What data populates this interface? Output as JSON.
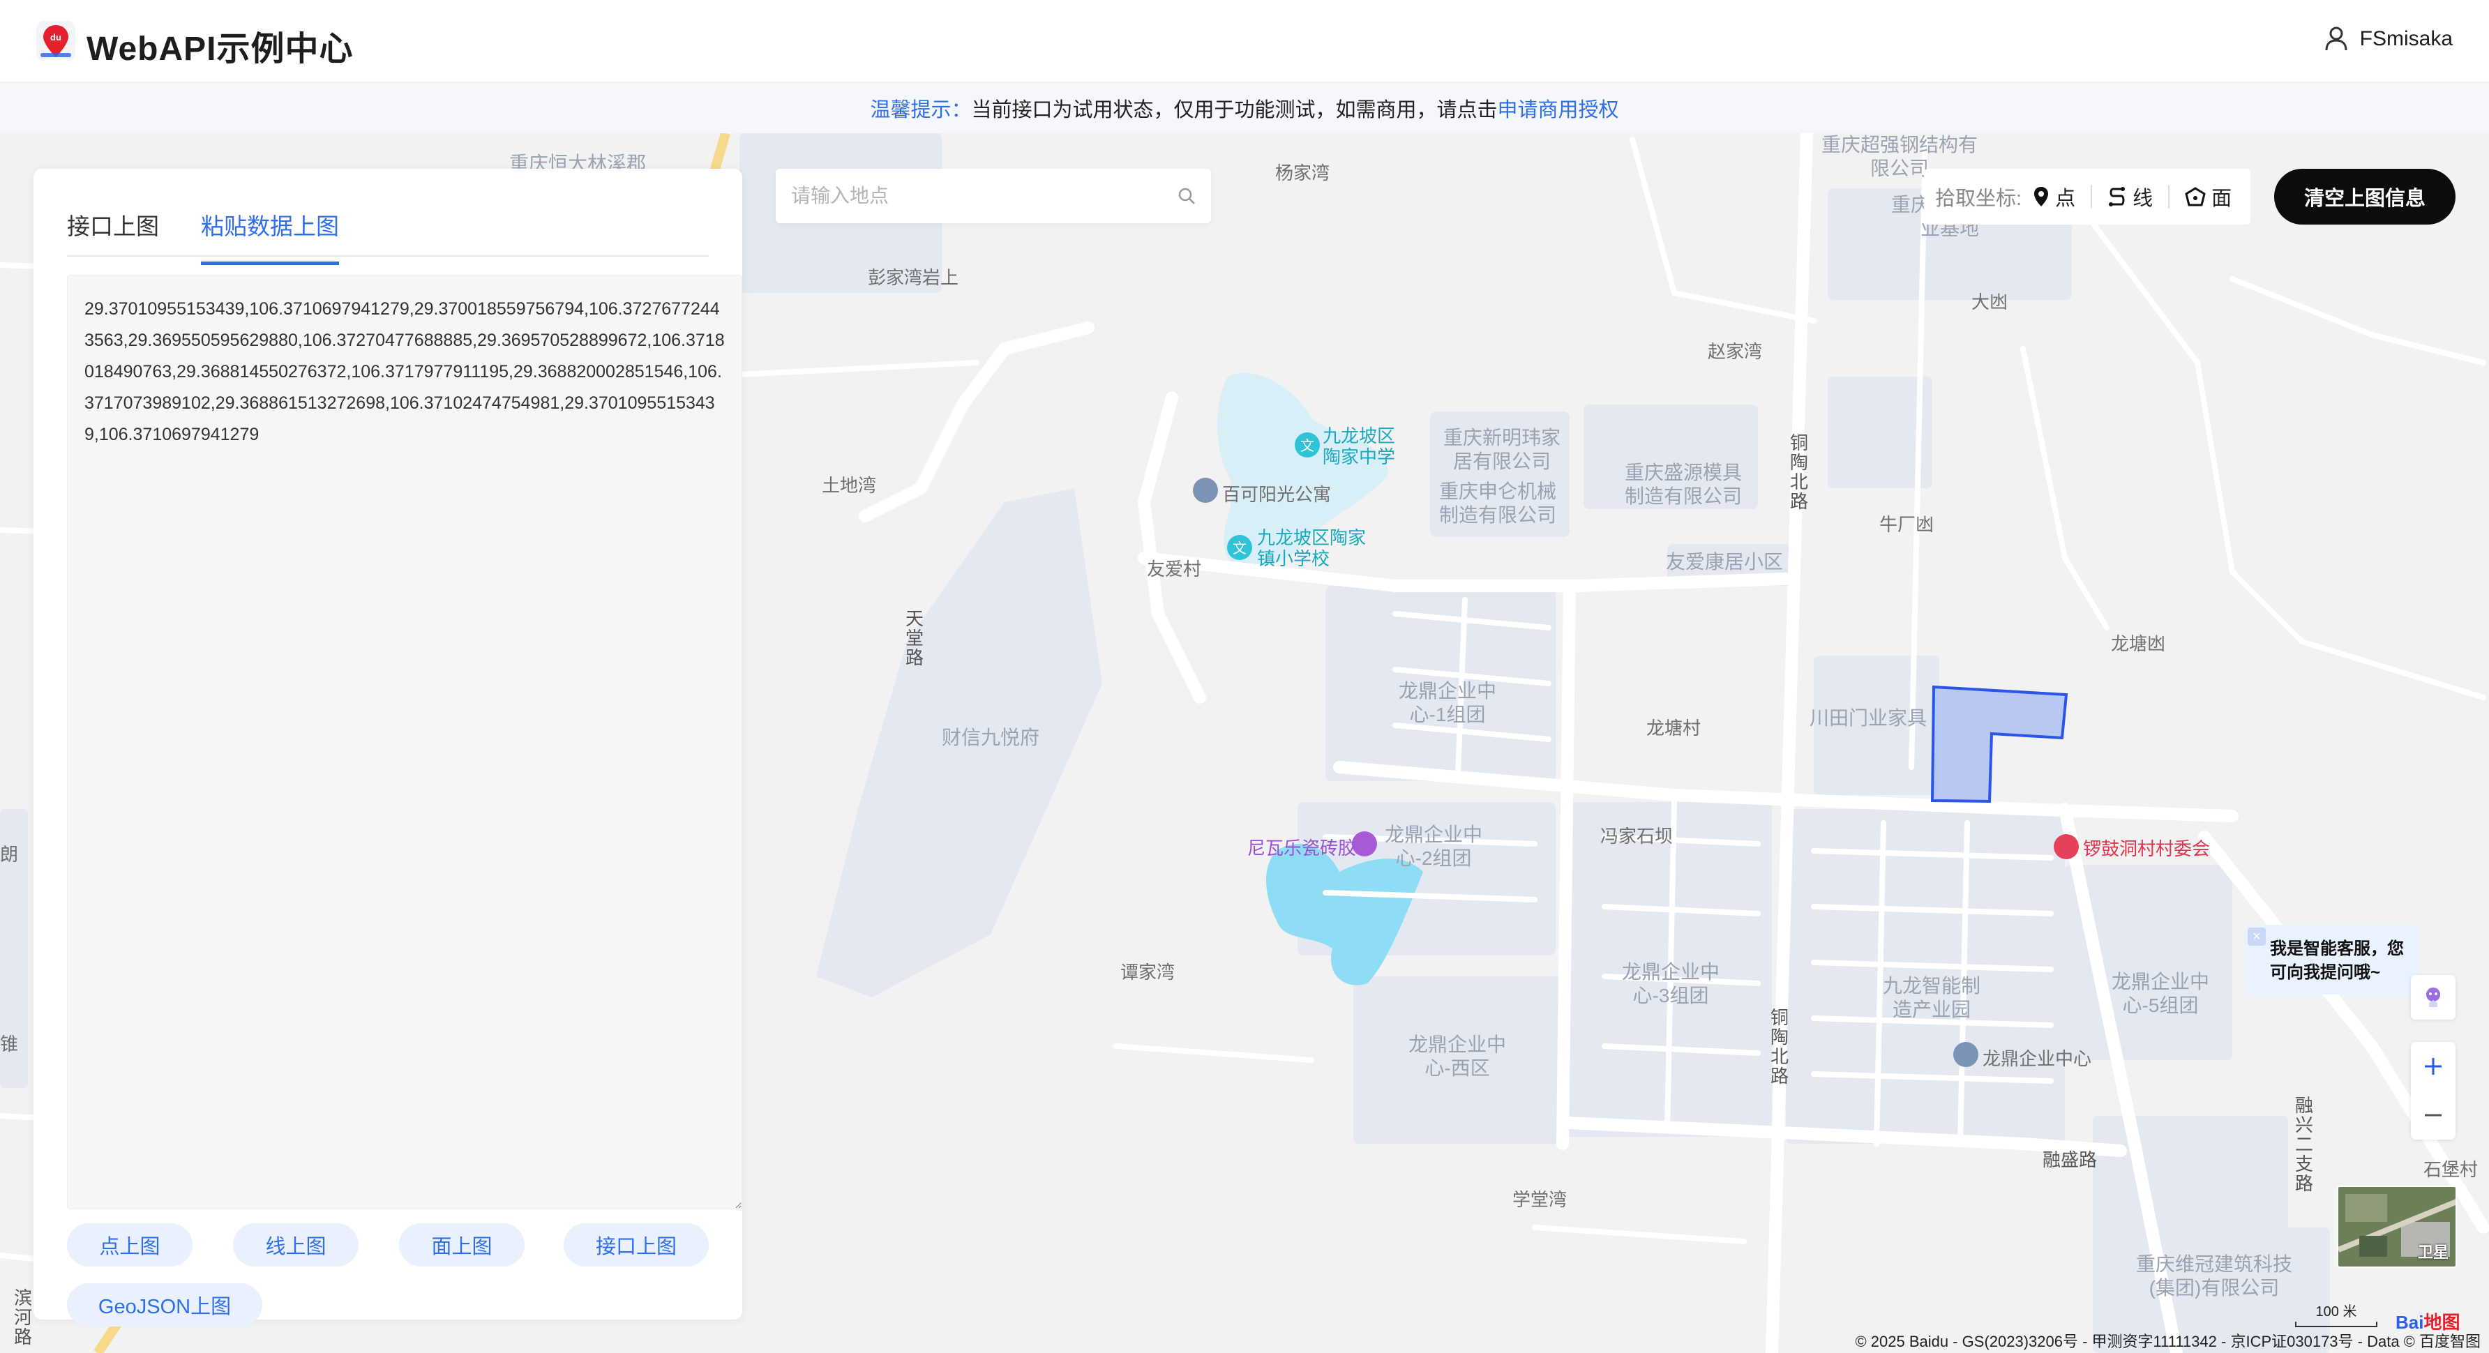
{
  "header": {
    "brand": "WebAPI示例中心",
    "user": "FSmisaka"
  },
  "tip": {
    "label": "温馨提示：",
    "text": "当前接口为试用状态，仅用于功能测试，如需商用，请点击",
    "link": "申请商用授权"
  },
  "panel": {
    "tabs": [
      "接口上图",
      "粘贴数据上图"
    ],
    "textarea_value": "29.37010955153439,106.3710697941279,29.370018559756794,106.37276772443563,29.369550595629880,106.37270477688885,29.369570528899672,106.3718018490763,29.368814550276372,106.3717977911195,29.368820002851546,106.3717073989102,29.368861513272698,106.37102474754981,29.37010955153439,106.3710697941279",
    "buttons": [
      "点上图",
      "线上图",
      "面上图",
      "接口上图",
      "GeoJSON上图"
    ]
  },
  "search": {
    "placeholder": "请输入地点"
  },
  "toolbar": {
    "label": "拾取坐标:",
    "point": "点",
    "line": "线",
    "polygon": "面",
    "clear": "清空上图信息"
  },
  "map": {
    "labels": {
      "l1": "重庆恒大林溪郡",
      "l2": "彭家湾岩上",
      "l3": "杨家湾",
      "l4": "赵家湾",
      "l5": "土地湾",
      "l6": "友爱村",
      "l7": "九龙坡区陶家中学",
      "l8": "百可阳光公寓",
      "l9": "九龙坡区陶家镇小学校",
      "l10": "重庆新明玮家居有限公司",
      "l11": "重庆申仑机械制造有限公司",
      "l12": "重庆盛源模具制造有限公司",
      "l13": "友爱康居小区",
      "l14": "重庆超强钢结构有限公司",
      "l15": "重庆小企业创业基地",
      "l16": "大凼",
      "l17": "牛厂凼",
      "l18": "龙塘凼",
      "l19": "铜陶北路",
      "l20": "财信九悦府",
      "l21": "龙鼎企业中心-1组团",
      "l22": "龙塘村",
      "l23": "川田门业家具",
      "l24": "天堂路",
      "l25": "冯家石坝",
      "l26": "尼瓦乐瓷砖胶",
      "l27": "龙鼎企业中心-2组团",
      "l28": "锣鼓洞村村委会",
      "l29": "谭家湾",
      "l30": "龙鼎企业中心-3组团",
      "l31": "九龙智能制造产业园",
      "l32": "龙鼎企业中心-5组团",
      "l33": "龙鼎企业中心-西区",
      "l34": "龙鼎企业中心",
      "l35": "铜陶北路",
      "l36": "融盛路",
      "l37": "融兴二支路",
      "l38": "学堂湾",
      "l39": "石堡村",
      "l40": "重庆维冠建筑科技(集团)有限公司",
      "l41": "滨河路",
      "l42": "朗",
      "l43": "锥"
    },
    "chat_bubble": "我是智能客服，您可向我提问哦~",
    "satellite_label": "卫星",
    "scale": "100 米",
    "copyright": "© 2025 Baidu - GS(2023)3206号 - 甲测资字11111342 - 京ICP证030173号 - Data © 百度智图",
    "logo_text": "Bai",
    "logo_text2": "地图"
  }
}
